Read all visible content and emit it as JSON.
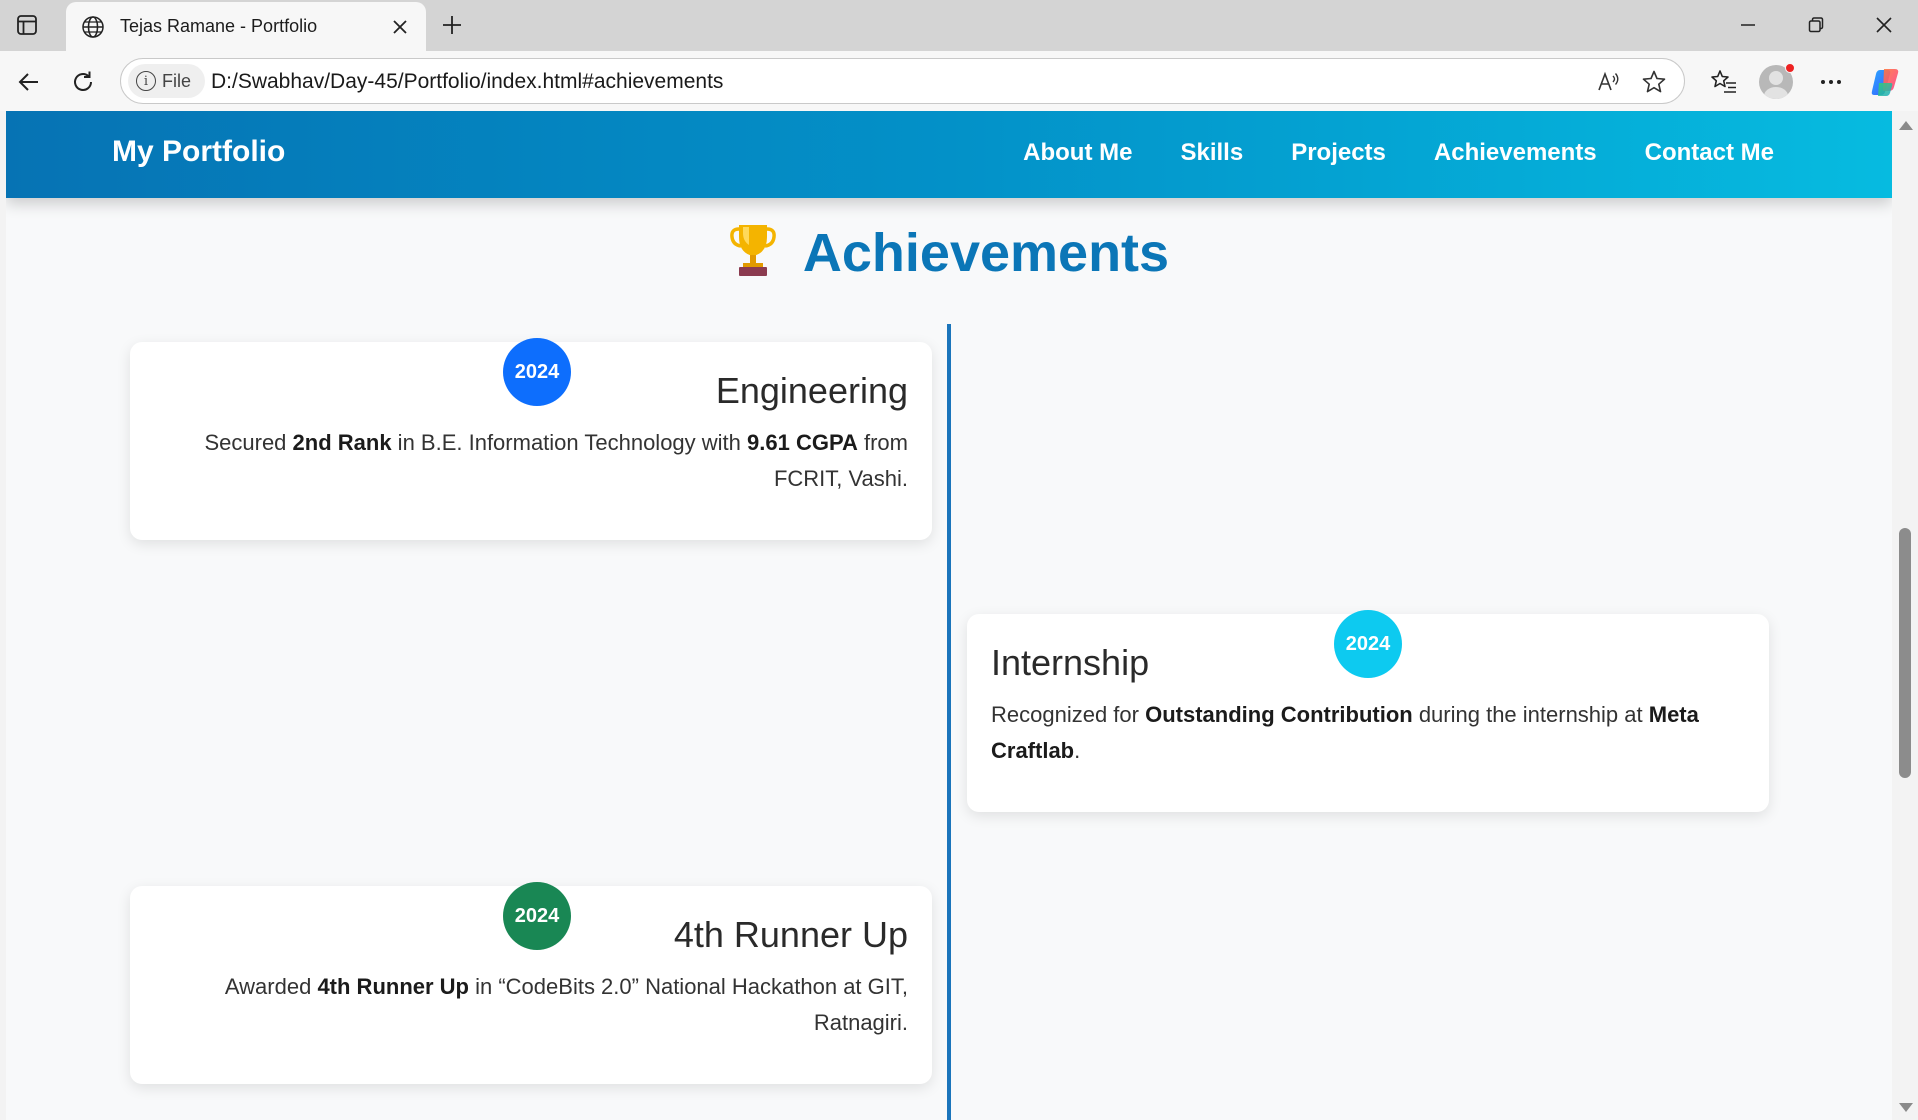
{
  "browser": {
    "tab_title": "Tejas Ramane - Portfolio",
    "file_chip": "File",
    "url": "D:/Swabhav/Day-45/Portfolio/index.html#achievements"
  },
  "site": {
    "brand": "My Portfolio",
    "nav": [
      "About Me",
      "Skills",
      "Projects",
      "Achievements",
      "Contact Me"
    ]
  },
  "section": {
    "title": "Achievements"
  },
  "achievements": [
    {
      "year": "2024",
      "title": "Engineering",
      "desc_parts": [
        "Secured ",
        "2nd Rank",
        " in B.E. Information Technology with ",
        "9.61 CGPA",
        " from FCRIT, Vashi."
      ],
      "badge_color": "#0d6efd"
    },
    {
      "year": "2024",
      "title": "Internship",
      "desc_parts": [
        "Recognized for ",
        "Outstanding Contribution",
        " during the internship at ",
        "Meta Craftlab",
        "."
      ],
      "badge_color": "#0dcaf0"
    },
    {
      "year": "2024",
      "title": "4th Runner Up",
      "desc_parts": [
        "Awarded ",
        "4th Runner Up",
        " in “CodeBits 2.0” National Hackathon at GIT, Ratnagiri."
      ],
      "badge_color": "#198754"
    }
  ],
  "colors": {
    "nav_gradient_start": "#0673b4",
    "nav_gradient_end": "#06bbe0",
    "title_color": "#0b76b7",
    "timeline_color": "#1b75bb"
  }
}
